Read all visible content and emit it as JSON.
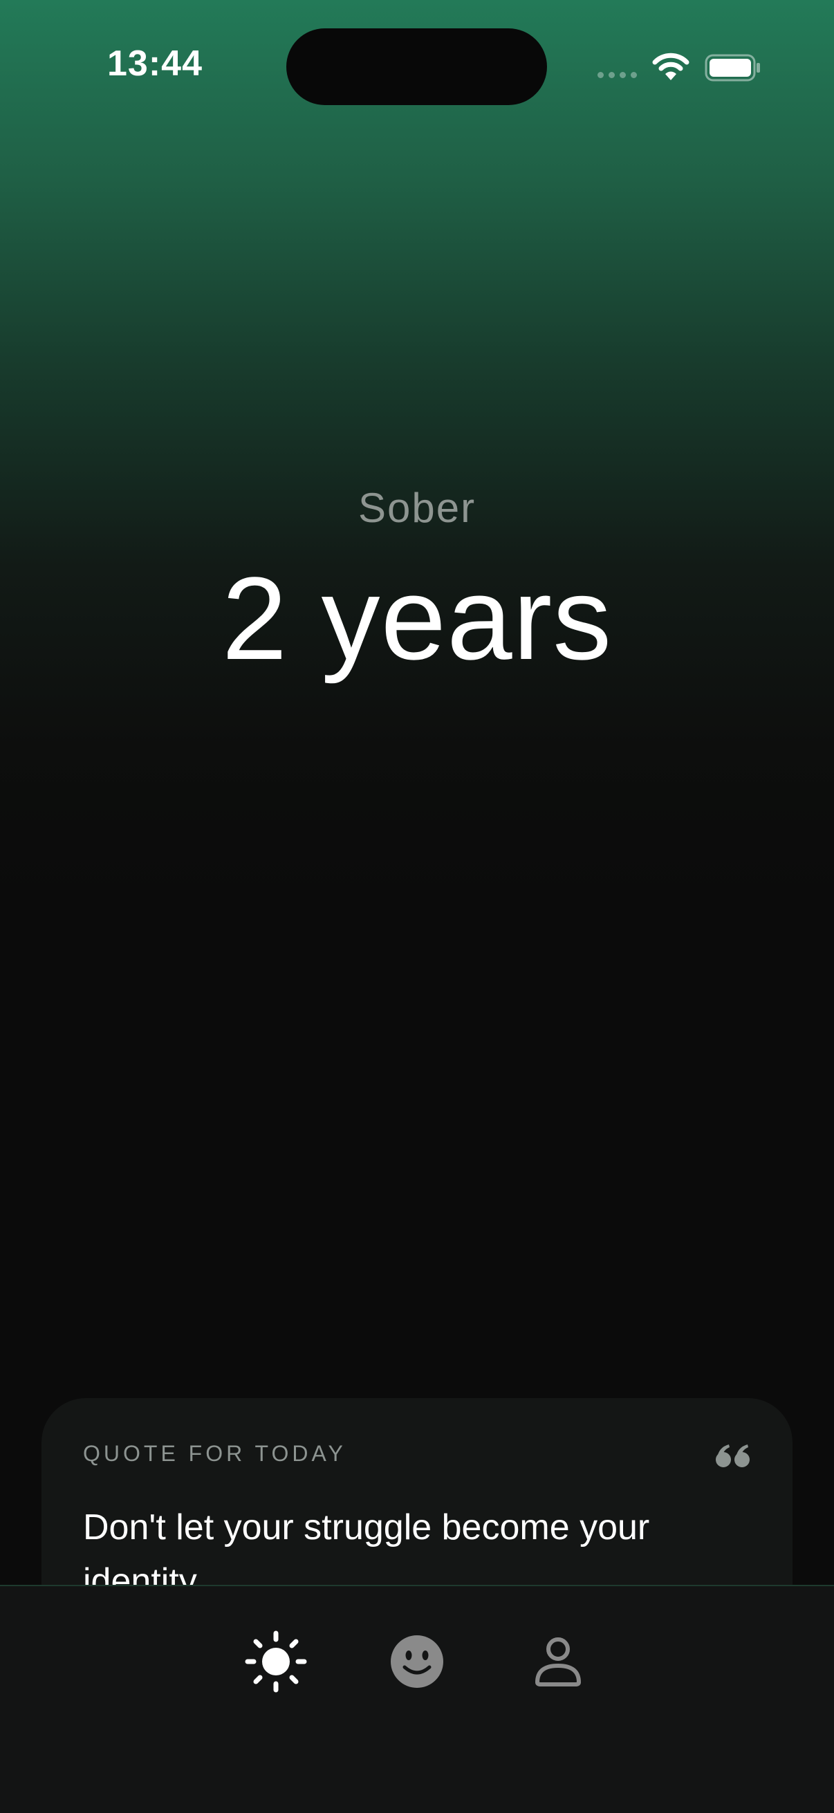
{
  "status_bar": {
    "time": "13:44",
    "icons": [
      "cellular-dots-icon",
      "wifi-icon",
      "battery-icon"
    ]
  },
  "hero": {
    "label": "Sober",
    "duration": "2 years"
  },
  "quote_card": {
    "heading": "QUOTE FOR TODAY",
    "icon": "quote-icon",
    "text": "Don't let your struggle become your identity"
  },
  "tab_bar": {
    "tabs": [
      {
        "icon": "sun-icon",
        "active": true
      },
      {
        "icon": "smiley-icon",
        "active": false
      },
      {
        "icon": "person-icon",
        "active": false
      }
    ]
  },
  "colors": {
    "gradient_top": "#237a58",
    "background": "#0b0b0b",
    "card": "#141615",
    "tab_bar": "#131414",
    "muted_text": "#8e9591",
    "inactive_icon": "#8a8a8a"
  }
}
